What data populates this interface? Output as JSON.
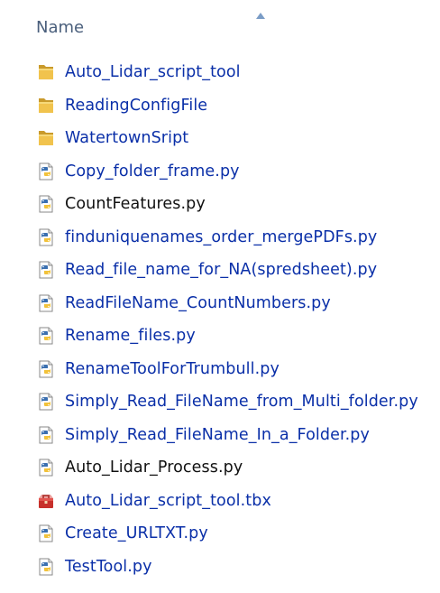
{
  "header": {
    "column_name": "Name"
  },
  "colors": {
    "link": "#0a2fa8",
    "text": "#111111",
    "header_text": "#4a5f7c",
    "folder": "#e8b53c"
  },
  "items": [
    {
      "label": "Auto_Lidar_script_tool",
      "icon": "folder-icon",
      "style": "blue"
    },
    {
      "label": "ReadingConfigFile",
      "icon": "folder-icon",
      "style": "blue"
    },
    {
      "label": "WatertownSript",
      "icon": "folder-icon",
      "style": "blue"
    },
    {
      "label": "Copy_folder_frame.py",
      "icon": "python-file-icon",
      "style": "blue"
    },
    {
      "label": "CountFeatures.py",
      "icon": "python-file-icon",
      "style": "black"
    },
    {
      "label": "finduniquenames_order_mergePDFs.py",
      "icon": "python-file-icon",
      "style": "blue"
    },
    {
      "label": "Read_file_name_for_NA(spredsheet).py",
      "icon": "python-file-icon",
      "style": "blue"
    },
    {
      "label": "ReadFileName_CountNumbers.py",
      "icon": "python-file-icon",
      "style": "blue"
    },
    {
      "label": "Rename_files.py",
      "icon": "python-file-icon",
      "style": "blue"
    },
    {
      "label": "RenameToolForTrumbull.py",
      "icon": "python-file-icon",
      "style": "blue"
    },
    {
      "label": "Simply_Read_FileName_from_Multi_folder.py",
      "icon": "python-file-icon",
      "style": "blue"
    },
    {
      "label": "Simply_Read_FileName_In_a_Folder.py",
      "icon": "python-file-icon",
      "style": "blue"
    },
    {
      "label": "Auto_Lidar_Process.py",
      "icon": "python-file-icon",
      "style": "black"
    },
    {
      "label": "Auto_Lidar_script_tool.tbx",
      "icon": "toolbox-icon",
      "style": "blue"
    },
    {
      "label": "Create_URLTXT.py",
      "icon": "python-file-icon",
      "style": "blue"
    },
    {
      "label": "TestTool.py",
      "icon": "python-file-icon",
      "style": "blue"
    }
  ]
}
